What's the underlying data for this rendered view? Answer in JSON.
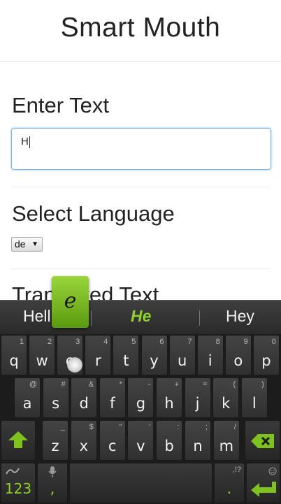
{
  "app": {
    "title": "Smart Mouth"
  },
  "sections": {
    "enter_text": {
      "title": "Enter Text",
      "value": "H"
    },
    "select_language": {
      "title": "Select Language",
      "selected": "de"
    },
    "translated_text": {
      "title": "Translated Text"
    }
  },
  "keyboard": {
    "suggestions": [
      "Hell",
      "He",
      "Hey"
    ],
    "popup_letter": "e",
    "row1": [
      {
        "main": "q",
        "sub": "1"
      },
      {
        "main": "w",
        "sub": "2"
      },
      {
        "main": "e",
        "sub": "3"
      },
      {
        "main": "r",
        "sub": "4"
      },
      {
        "main": "t",
        "sub": "5"
      },
      {
        "main": "y",
        "sub": "6"
      },
      {
        "main": "u",
        "sub": "7"
      },
      {
        "main": "i",
        "sub": "8"
      },
      {
        "main": "o",
        "sub": "9"
      },
      {
        "main": "p",
        "sub": "0"
      }
    ],
    "row2": [
      {
        "main": "a",
        "sub": "@"
      },
      {
        "main": "s",
        "sub": "#"
      },
      {
        "main": "d",
        "sub": "&"
      },
      {
        "main": "f",
        "sub": "*"
      },
      {
        "main": "g",
        "sub": "-"
      },
      {
        "main": "h",
        "sub": "+"
      },
      {
        "main": "j",
        "sub": "="
      },
      {
        "main": "k",
        "sub": "("
      },
      {
        "main": "l",
        "sub": ")"
      }
    ],
    "row3": [
      {
        "main": "z",
        "sub": "_"
      },
      {
        "main": "x",
        "sub": "$"
      },
      {
        "main": "c",
        "sub": "\""
      },
      {
        "main": "v",
        "sub": "'"
      },
      {
        "main": "b",
        "sub": ":"
      },
      {
        "main": "n",
        "sub": ";"
      },
      {
        "main": "m",
        "sub": "/"
      }
    ],
    "numbers_label": "123",
    "comma_label": ",",
    "period_label": ".",
    "period_sub": ",!?",
    "accent_color": "#8fd12d"
  }
}
